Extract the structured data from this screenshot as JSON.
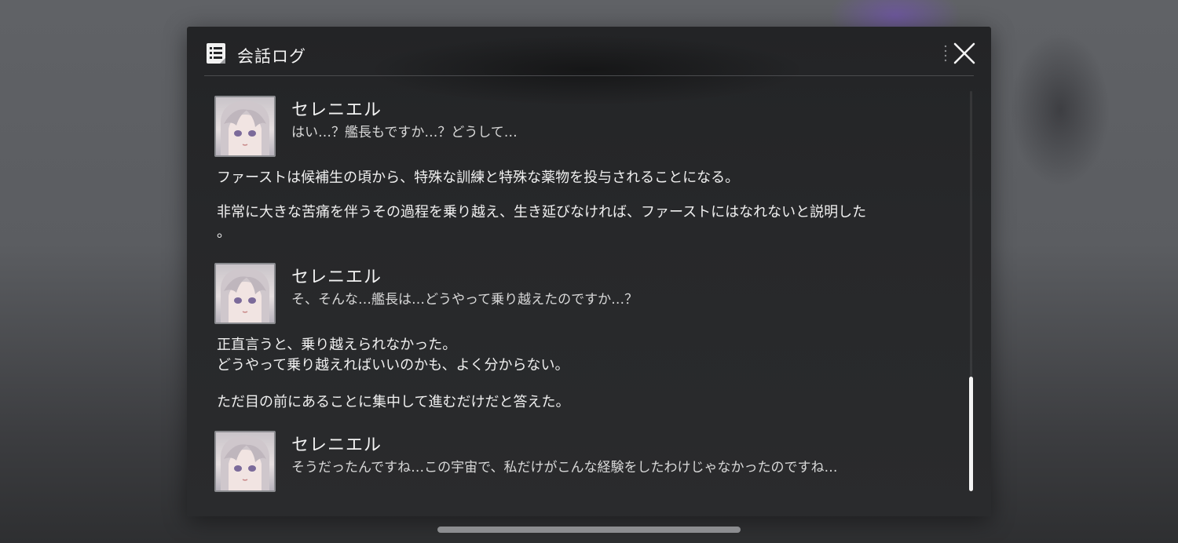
{
  "dialog": {
    "title": "会話ログ",
    "title_icon": "log-document-icon",
    "close_icon": "close-icon"
  },
  "entries": [
    {
      "type": "speech",
      "speaker": "セレニエル",
      "text": "はい…？艦長もですか…？どうして…"
    },
    {
      "type": "narration",
      "text": "ファーストは候補生の頃から、特殊な訓練と特殊な薬物を投与されることになる。"
    },
    {
      "type": "narration",
      "text": "非常に大きな苦痛を伴うその過程を乗り越え、生き延びなければ、ファーストにはなれないと説明した\n。"
    },
    {
      "type": "speech",
      "speaker": "セレニエル",
      "text": "そ、そんな…艦長は…どうやって乗り越えたのですか…？"
    },
    {
      "type": "narration",
      "text": "正直言うと、乗り越えられなかった。\nどうやって乗り越えればいいのかも、よく分からない。"
    },
    {
      "type": "narration",
      "text": "ただ目の前にあることに集中して進むだけだと答えた。"
    },
    {
      "type": "speech",
      "speaker": "セレニエル",
      "text": "そうだったんですね…この宇宙で、私だけがこんな経験をしたわけじゃなかったのですね…"
    }
  ],
  "scroll": {
    "position_fraction": 0.71,
    "thumb_fraction": 0.29
  },
  "colors": {
    "panel_bg": "#27282a",
    "text_primary": "#f0f0f0",
    "text_secondary": "#d8d8d8",
    "scroll_thumb": "#f4f4f4"
  }
}
